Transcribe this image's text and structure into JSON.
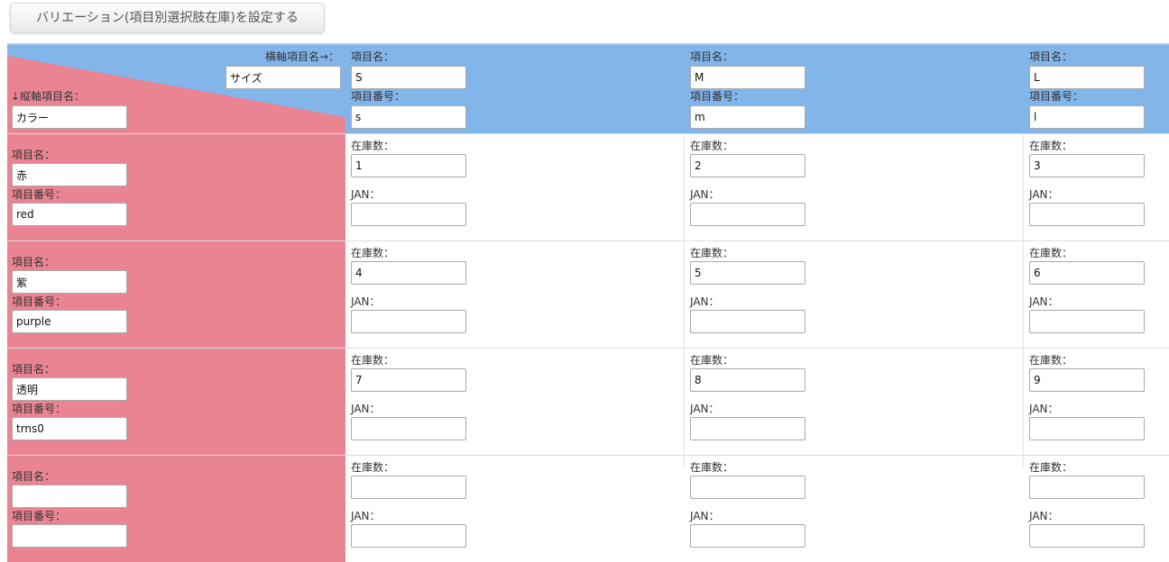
{
  "variation_button_label": "バリエーション(項目別選択肢在庫)を設定する",
  "colors": {
    "row_header": "#ea8493",
    "column_header": "#82b5ea"
  },
  "corner": {
    "horizontal_axis_label": "横軸項目名→：",
    "horizontal_axis_value": "サイズ",
    "vertical_axis_label": "↓縦軸項目名：",
    "vertical_axis_value": "カラー"
  },
  "field_labels": {
    "item_name": "項目名：",
    "item_number": "項目番号：",
    "stock": "在庫数：",
    "jan": "JAN："
  },
  "columns": [
    {
      "name": "S",
      "number": "s"
    },
    {
      "name": "M",
      "number": "m"
    },
    {
      "name": "L",
      "number": "l"
    }
  ],
  "rows": [
    {
      "name": "赤",
      "number": "red",
      "stock": [
        "1",
        "2",
        "3"
      ],
      "jan": [
        "",
        "",
        ""
      ]
    },
    {
      "name": "紫",
      "number": "purple",
      "stock": [
        "4",
        "5",
        "6"
      ],
      "jan": [
        "",
        "",
        ""
      ]
    },
    {
      "name": "透明",
      "number": "trns0",
      "stock": [
        "7",
        "8",
        "9"
      ],
      "jan": [
        "",
        "",
        ""
      ]
    },
    {
      "name": "",
      "number": "",
      "stock": [
        "",
        "",
        ""
      ],
      "jan": [
        "",
        "",
        ""
      ]
    }
  ]
}
